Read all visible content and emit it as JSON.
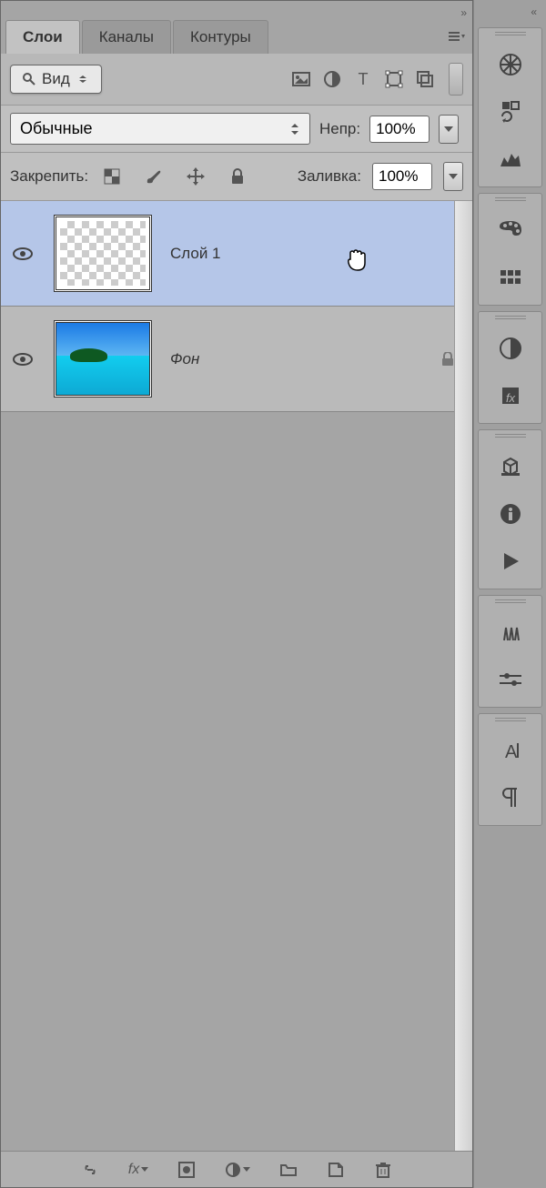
{
  "topbar": {
    "collapse_l": "»",
    "collapse_r": "«"
  },
  "tabs": {
    "t1": "Слои",
    "t2": "Каналы",
    "t3": "Контуры"
  },
  "toolbar1": {
    "view": "Вид"
  },
  "toolbar2": {
    "blend": "Обычные",
    "opacity_label": "Непр:",
    "opacity_value": "100%"
  },
  "toolbar3": {
    "lock_label": "Закрепить:",
    "fill_label": "Заливка:",
    "fill_value": "100%"
  },
  "layers": [
    {
      "name": "Слой 1",
      "locked": false,
      "selected": true,
      "type": "empty"
    },
    {
      "name": "Фон",
      "locked": true,
      "selected": false,
      "type": "image"
    }
  ]
}
